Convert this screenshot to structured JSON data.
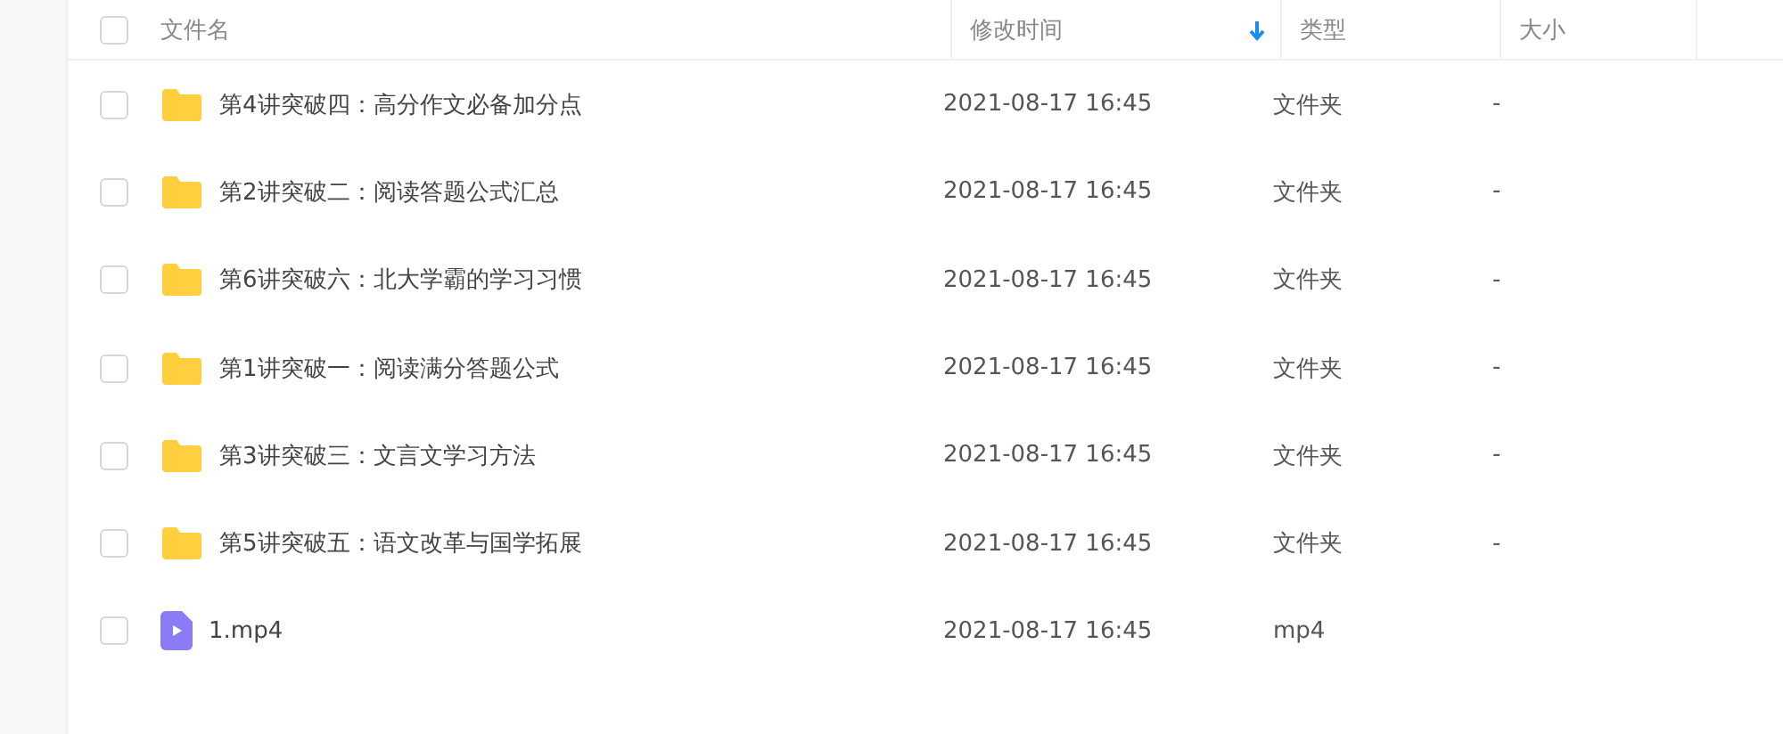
{
  "table": {
    "select_all": {
      "checked": false
    },
    "columns": [
      {
        "label": "文件名",
        "sorted": false
      },
      {
        "label": "修改时间",
        "sorted": true
      },
      {
        "label": "类型",
        "sorted": false
      },
      {
        "label": "大小",
        "sorted": false
      }
    ],
    "rows": [
      {
        "kind": "folder",
        "checked": false,
        "name": "第4讲突破四：高分作文必备加分点",
        "modified": "2021-08-17 16:45",
        "type": "文件夹",
        "size": "-"
      },
      {
        "kind": "folder",
        "checked": false,
        "name": "第2讲突破二：阅读答题公式汇总",
        "modified": "2021-08-17 16:45",
        "type": "文件夹",
        "size": "-"
      },
      {
        "kind": "folder",
        "checked": false,
        "name": "第6讲突破六：北大学霸的学习习惯",
        "modified": "2021-08-17 16:45",
        "type": "文件夹",
        "size": "-"
      },
      {
        "kind": "folder",
        "checked": false,
        "name": "第1讲突破一：阅读满分答题公式",
        "modified": "2021-08-17 16:45",
        "type": "文件夹",
        "size": "-"
      },
      {
        "kind": "folder",
        "checked": false,
        "name": "第3讲突破三：文言文学习方法",
        "modified": "2021-08-17 16:45",
        "type": "文件夹",
        "size": "-"
      },
      {
        "kind": "folder",
        "checked": false,
        "name": "第5讲突破五：语文改革与国学拓展",
        "modified": "2021-08-17 16:45",
        "type": "文件夹",
        "size": "-"
      },
      {
        "kind": "video",
        "checked": false,
        "name": "1.mp4",
        "modified": "2021-08-17 16:45",
        "type": "mp4"
      }
    ]
  }
}
